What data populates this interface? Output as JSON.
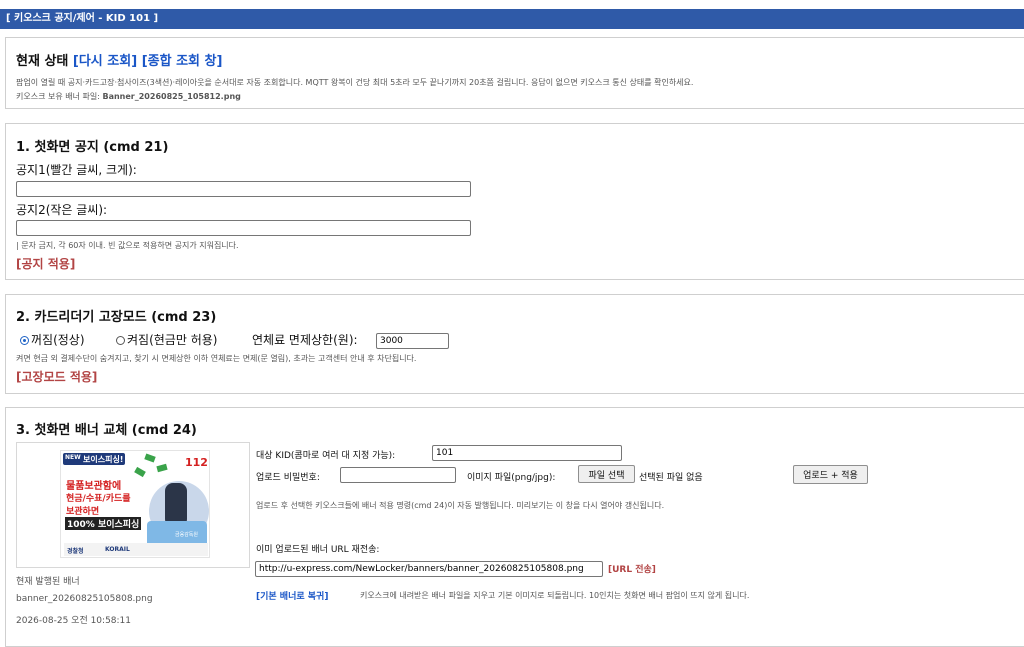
{
  "window": {
    "title": "[ 키오스크 공지/제어 - KID 101 ]"
  },
  "status": {
    "heading": "현재 상태",
    "reload_link": "[다시 조회]",
    "overview_link": "[종합 조회 창]",
    "desc": "팝업이 열릴 때 공지·카드고장·첨사이즈(3색션)·레이아웃을 순서대로 자동 조회합니다. MQTT 왕복이 건당 최대 5초라 모두 끝나기까지 20초쯤 걸립니다. 응답이 없으면 키오스크 통신 상태를 확인하세요.",
    "banner_file_label": "키오스크 보유 배너 파일:",
    "banner_file_value": "Banner_20260825_105812.png"
  },
  "notice": {
    "heading": "1. 첫화면 공지 (cmd 21)",
    "field1_label": "공지1(빨간 글씨, 크게):",
    "field1_value": "",
    "field2_label": "공지2(작은 글씨):",
    "field2_value": "",
    "hint": "| 문자 금지, 각 60자 이내. 빈 값으로 적용하면 공지가 지워집니다.",
    "apply_link": "[공지 적용]"
  },
  "card": {
    "heading": "2. 카드리더기 고장모드 (cmd 23)",
    "radio_off": "꺼짐(정상)",
    "radio_on": "켜짐(현금만 허용)",
    "selected": "off",
    "limit_label": "연체료 면제상한(원):",
    "limit_value": "3000",
    "hint": "켜면 현금 외 결제수단이 숨겨지고, 찾기 시 면제상한 이하 연체료는 면제(문 열림), 초과는 고객센터 안내 후 차단됩니다.",
    "apply_link": "[고장모드 적용]"
  },
  "banner": {
    "heading": "3. 첫화면 배너 교체 (cmd 24)",
    "preview": {
      "badge_small": "NEW",
      "badge_title": "보이스피싱!",
      "number": "112",
      "line1": "물품보관함에",
      "line2": "현금/수표/카드를",
      "line3": "보관하면",
      "line4": "100% 보이스피싱",
      "footer1": "경찰청",
      "footer2": "KORAIL",
      "tag": "금융감독원"
    },
    "current_label": "현재 발행된 배너",
    "current_file": "banner_20260825105808.png",
    "current_time": "2026-08-25 오전 10:58:11",
    "target_label": "대상 KID(콤마로 여러 대 지정 가능):",
    "target_value": "101",
    "password_label": "업로드 비밀번호:",
    "password_value": "",
    "image_label": "이미지 파일(png/jpg):",
    "choose_file_button": "파일 선택",
    "no_file": "선택된 파일 없음",
    "upload_button": "업로드 + 적용",
    "upload_hint": "업로드 후 선택한 키오스크들에 배너 적용 명령(cmd 24)이 자동 발행됩니다. 미리보기는 이 창을 다시 열어야 갱신됩니다.",
    "resend_label": "이미 업로드된 배너 URL 재전송:",
    "url_value": "http://u-express.com/NewLocker/banners/banner_20260825105808.png",
    "url_send_link": "[URL 전송]",
    "restore_link": "[기본 배너로 복귀]",
    "restore_hint": "키오스크에 내려받은 배너 파일을 지우고 기본 이미지로 되돌립니다. 10인치는 첫화면 배너 팝업이 뜨지 않게 됩니다."
  },
  "colors": {
    "titlebar": "#2f5aa8",
    "link": "#1a56c7",
    "apply": "#b24444"
  }
}
